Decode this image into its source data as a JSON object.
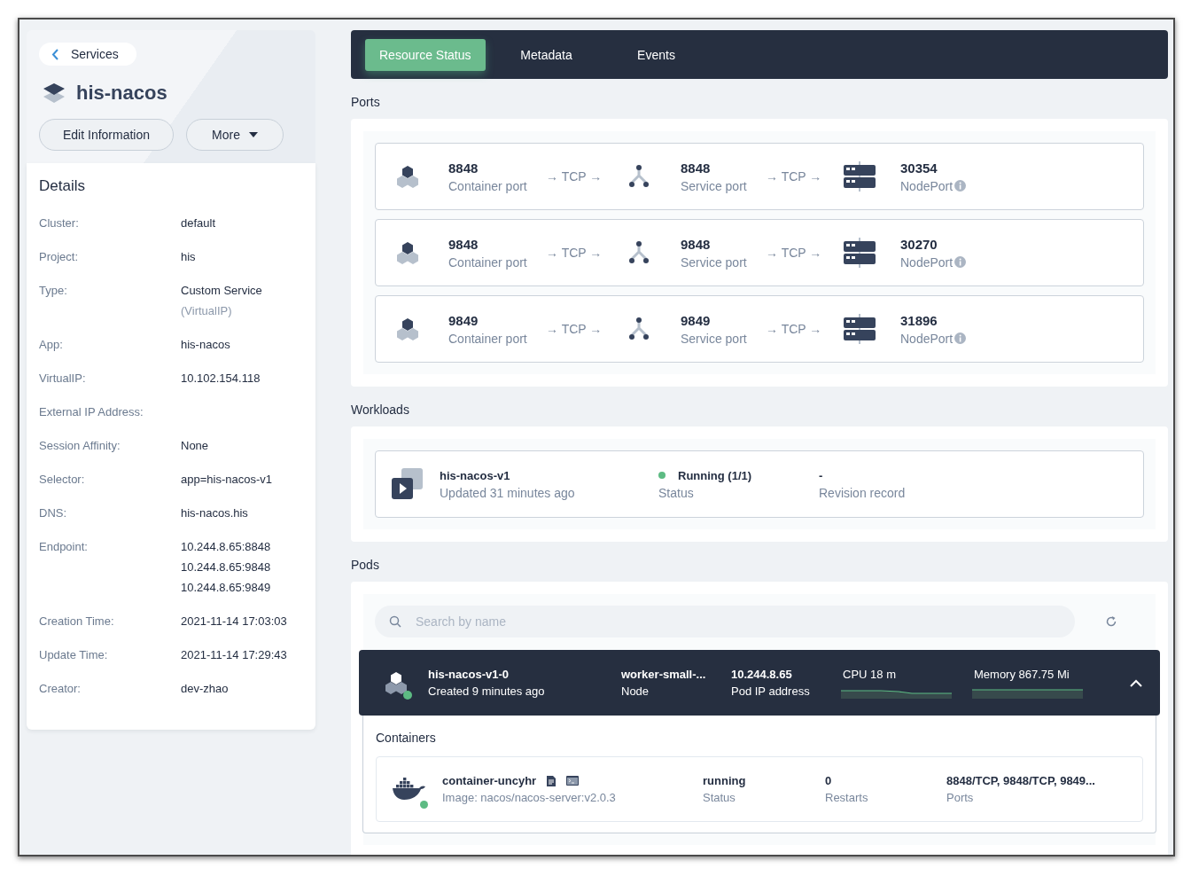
{
  "back_link": {
    "label": "Services"
  },
  "service": {
    "name": "his-nacos"
  },
  "actions": [
    {
      "label": "Edit Information",
      "kind": "plain"
    },
    {
      "label": "More",
      "kind": "dropdown"
    }
  ],
  "details": {
    "title": "Details",
    "rows": [
      {
        "label": "Cluster:",
        "values": [
          "default"
        ]
      },
      {
        "label": "Project:",
        "values": [
          "his"
        ]
      },
      {
        "label": "Type:",
        "values": [
          "Custom Service"
        ],
        "note": "(VirtualIP)"
      },
      {
        "label": "App:",
        "values": [
          "his-nacos"
        ]
      },
      {
        "label": "VirtualIP:",
        "values": [
          "10.102.154.118"
        ]
      },
      {
        "label": "External IP Address:",
        "values": []
      },
      {
        "label": "Session Affinity:",
        "values": [
          "None"
        ]
      },
      {
        "label": "Selector:",
        "values": [
          "app=his-nacos-v1"
        ]
      },
      {
        "label": "DNS:",
        "values": [
          "his-nacos.his"
        ]
      },
      {
        "label": "Endpoint:",
        "values": [
          "10.244.8.65:8848",
          "10.244.8.65:9848",
          "10.244.8.65:9849"
        ]
      },
      {
        "label": "Creation Time:",
        "values": [
          "2021-11-14 17:03:03"
        ]
      },
      {
        "label": "Update Time:",
        "values": [
          "2021-11-14 17:29:43"
        ]
      },
      {
        "label": "Creator:",
        "values": [
          "dev-zhao"
        ]
      }
    ]
  },
  "tabs": [
    {
      "label": "Resource Status",
      "selected": true
    },
    {
      "label": "Metadata",
      "selected": false
    },
    {
      "label": "Events",
      "selected": false
    }
  ],
  "ports": {
    "title": "Ports",
    "rows": [
      {
        "container_port": "8848",
        "container_label": "Container port",
        "protocol_1": "→ TCP →",
        "service_port": "8848",
        "service_label": "Service port",
        "protocol_2": "→ TCP →",
        "node_port": "30354",
        "node_label": "NodePort"
      },
      {
        "container_port": "9848",
        "container_label": "Container port",
        "protocol_1": "→ TCP →",
        "service_port": "9848",
        "service_label": "Service port",
        "protocol_2": "→ TCP →",
        "node_port": "30270",
        "node_label": "NodePort"
      },
      {
        "container_port": "9849",
        "container_label": "Container port",
        "protocol_1": "→ TCP →",
        "service_port": "9849",
        "service_label": "Service port",
        "protocol_2": "→ TCP →",
        "node_port": "31896",
        "node_label": "NodePort"
      }
    ]
  },
  "workloads": {
    "title": "Workloads",
    "items": [
      {
        "name": "his-nacos-v1",
        "updated": "Updated 31 minutes ago",
        "status": "Running (1/1)",
        "status_label": "Status",
        "color": "#5dbb83",
        "revision": "-",
        "revision_label": "Revision record"
      }
    ]
  },
  "pods": {
    "title": "Pods",
    "search": {
      "placeholder": "Search by name"
    },
    "items": [
      {
        "name": "his-nacos-v1-0",
        "created": "Created 9 minutes ago",
        "color": "#5dbb83",
        "node": "worker-small-...",
        "node_label": "Node",
        "ip": "10.244.8.65",
        "ip_label": "Pod IP address",
        "cpu": "CPU 18 m",
        "memory": "Memory 867.75 Mi",
        "expanded": true,
        "containers_title": "Containers",
        "containers": [
          {
            "name": "container-uncyhr",
            "image": "Image: nacos/nacos-server:v2.0.3",
            "color": "#5dbb83",
            "status": "running",
            "status_label": "Status",
            "restarts": "0",
            "restarts_label": "Restarts",
            "ports": "8848/TCP, 9848/TCP, 9849...",
            "ports_label": "Ports"
          }
        ]
      }
    ]
  }
}
